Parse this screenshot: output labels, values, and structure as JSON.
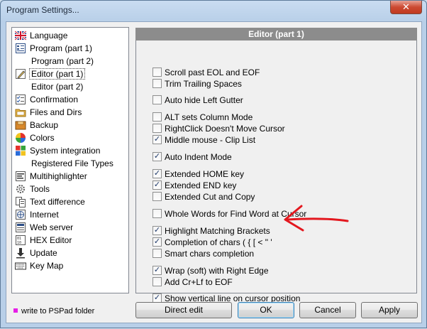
{
  "window": {
    "title": "Program Settings...",
    "close_glyph": "✕"
  },
  "nav": {
    "items": [
      {
        "label": "Language",
        "icon": "uk-flag-icon"
      },
      {
        "label": "Program  (part 1)",
        "icon": "program-icon"
      },
      {
        "label": "Program  (part 2)",
        "icon": ""
      },
      {
        "label": "Editor  (part 1)",
        "icon": "pencil-icon",
        "selected": true
      },
      {
        "label": "Editor  (part 2)",
        "icon": ""
      },
      {
        "label": "Confirmation",
        "icon": "checklist-icon"
      },
      {
        "label": "Files and Dirs",
        "icon": "folder-icon"
      },
      {
        "label": "Backup",
        "icon": "backup-icon"
      },
      {
        "label": "Colors",
        "icon": "color-wheel-icon"
      },
      {
        "label": "System integration",
        "icon": "windows-logo-icon"
      },
      {
        "label": "Registered File Types",
        "icon": ""
      },
      {
        "label": "Multihighlighter",
        "icon": "highlighter-icon"
      },
      {
        "label": "Tools",
        "icon": "gear-icon"
      },
      {
        "label": "Text difference",
        "icon": "text-diff-icon"
      },
      {
        "label": "Internet",
        "icon": "globe-icon"
      },
      {
        "label": "Web server",
        "icon": "web-server-icon"
      },
      {
        "label": "HEX Editor",
        "icon": "hex-icon"
      },
      {
        "label": "Update",
        "icon": "download-icon"
      },
      {
        "label": "Key Map",
        "icon": "keyboard-icon"
      }
    ]
  },
  "legend": {
    "text": "write to PSPad folder",
    "color": "#e61fe6"
  },
  "panel": {
    "header": "Editor  (part 1)",
    "options": [
      {
        "label": "Scroll past EOL and EOF",
        "checked": false
      },
      {
        "label": "Trim Trailing Spaces",
        "checked": false
      },
      {
        "label": "Auto hide Left Gutter",
        "checked": false
      },
      {
        "label": "ALT sets Column Mode",
        "checked": false
      },
      {
        "label": "RightClick Doesn't Move Cursor",
        "checked": false
      },
      {
        "label": "Middle mouse - Clip List",
        "checked": true
      },
      {
        "label": "Auto Indent Mode",
        "checked": true
      },
      {
        "label": "Extended HOME key",
        "checked": true
      },
      {
        "label": "Extended END key",
        "checked": true
      },
      {
        "label": "Extended Cut and Copy",
        "checked": false
      },
      {
        "label": "Whole Words for Find Word at Cursor",
        "checked": false
      },
      {
        "label": "Highlight Matching Brackets",
        "checked": true
      },
      {
        "label": "Completion of chars ( { [ < \" '",
        "checked": true
      },
      {
        "label": "Smart chars completion",
        "checked": false
      },
      {
        "label": "Wrap (soft) with Right Edge",
        "checked": true
      },
      {
        "label": "Add Cr+Lf to EOF",
        "checked": false
      },
      {
        "label": "Show vertical line on cursor position",
        "checked": true
      }
    ]
  },
  "buttons": {
    "direct_edit": "Direct edit",
    "ok": "OK",
    "cancel": "Cancel",
    "apply": "Apply"
  },
  "annotation": {
    "arrow_color": "#e3171e"
  }
}
